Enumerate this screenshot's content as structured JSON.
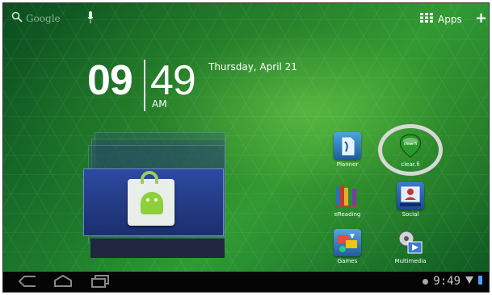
{
  "topbar": {
    "search_label": "Google",
    "apps_label": "Apps"
  },
  "clock": {
    "hours": "09",
    "minutes": "49",
    "ampm": "AM",
    "date": "Thursday, April 21"
  },
  "shortcuts": [
    {
      "label": "Planner",
      "icon": "planner-icon"
    },
    {
      "label": "clear.fi",
      "icon": "clearfi-icon"
    },
    {
      "label": "eReading",
      "icon": "ereading-icon"
    },
    {
      "label": "Social",
      "icon": "social-icon"
    },
    {
      "label": "Games",
      "icon": "games-icon"
    },
    {
      "label": "Multimedia",
      "icon": "multimedia-icon"
    }
  ],
  "statusbar": {
    "time": "9:49"
  },
  "colors": {
    "wallpaper": "#1d7a2c",
    "navbar": "#050505",
    "highlight_ring": "#d8d8d8"
  }
}
